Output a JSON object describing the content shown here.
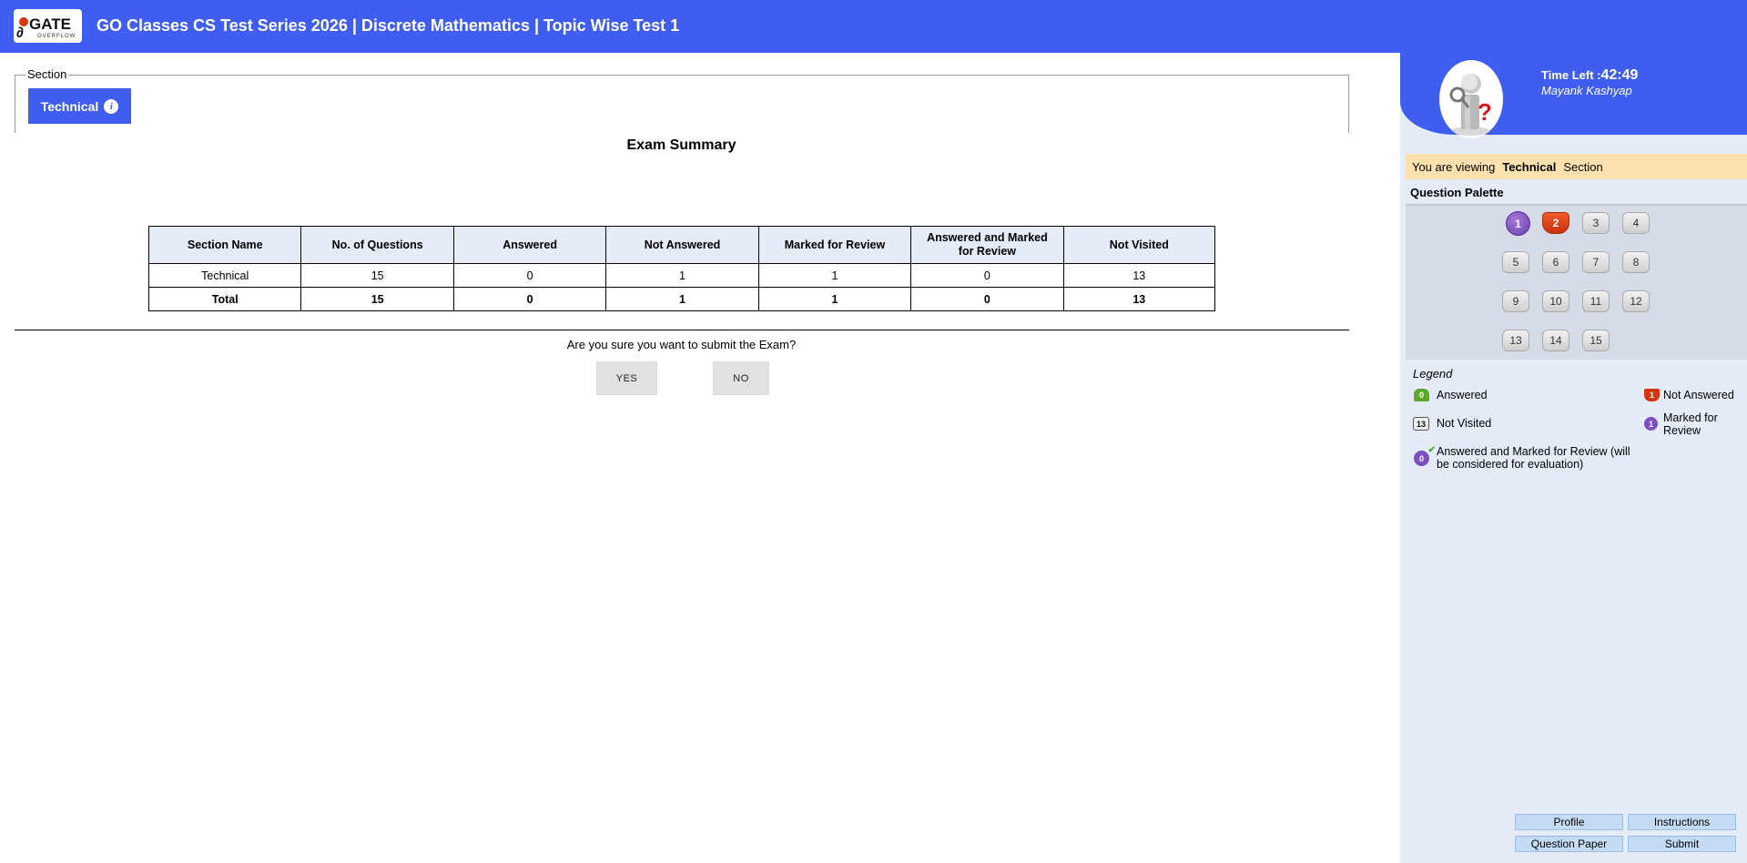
{
  "header": {
    "title": "GO Classes CS Test Series 2026 | Discrete Mathematics | Topic Wise Test 1",
    "logo_text": "GATE",
    "logo_subtext": "OVERFLOW"
  },
  "section": {
    "legend": "Section",
    "tab_label": "Technical",
    "info_icon": "i"
  },
  "summary": {
    "title": "Exam Summary",
    "headers": [
      "Section Name",
      "No. of Questions",
      "Answered",
      "Not Answered",
      "Marked for Review",
      "Answered and Marked for Review",
      "Not Visited"
    ],
    "rows": [
      [
        "Technical",
        "15",
        "0",
        "1",
        "1",
        "0",
        "13"
      ],
      [
        "Total",
        "15",
        "0",
        "1",
        "1",
        "0",
        "13"
      ]
    ]
  },
  "confirm": {
    "question": "Are you sure you want to submit the Exam?",
    "yes_label": "YES",
    "no_label": "NO"
  },
  "sidebar": {
    "time_left_label": "Time Left :",
    "time_left_value": "42:49",
    "user_name": "Mayank Kashyap",
    "viewing_prefix": "You are viewing",
    "viewing_section": "Technical",
    "viewing_suffix": "Section",
    "palette_title": "Question Palette",
    "questions": [
      {
        "num": "1",
        "status": "marked-for-review"
      },
      {
        "num": "2",
        "status": "not-answered"
      },
      {
        "num": "3",
        "status": "not-visited"
      },
      {
        "num": "4",
        "status": "not-visited"
      },
      {
        "num": "5",
        "status": "not-visited"
      },
      {
        "num": "6",
        "status": "not-visited"
      },
      {
        "num": "7",
        "status": "not-visited"
      },
      {
        "num": "8",
        "status": "not-visited"
      },
      {
        "num": "9",
        "status": "not-visited"
      },
      {
        "num": "10",
        "status": "not-visited"
      },
      {
        "num": "11",
        "status": "not-visited"
      },
      {
        "num": "12",
        "status": "not-visited"
      },
      {
        "num": "13",
        "status": "not-visited"
      },
      {
        "num": "14",
        "status": "not-visited"
      },
      {
        "num": "15",
        "status": "not-visited"
      }
    ],
    "legend": {
      "title": "Legend",
      "answered": {
        "count": "0",
        "label": "Answered"
      },
      "not_answered": {
        "count": "1",
        "label": "Not Answered"
      },
      "not_visited": {
        "count": "13",
        "label": "Not Visited"
      },
      "marked_for_review": {
        "count": "1",
        "label": "Marked for Review"
      },
      "answered_marked": {
        "count": "0",
        "label": "Answered and Marked for Review (will be considered for evaluation)"
      }
    },
    "buttons": {
      "profile": "Profile",
      "instructions": "Instructions",
      "question_paper": "Question Paper",
      "submit": "Submit"
    }
  },
  "colors": {
    "brand_blue": "#3f5ef0",
    "panel_bg": "#e4ecf7",
    "not_answered": "#d7330e",
    "answered": "#5da82b",
    "marked_for_review": "#7d4fc0"
  }
}
